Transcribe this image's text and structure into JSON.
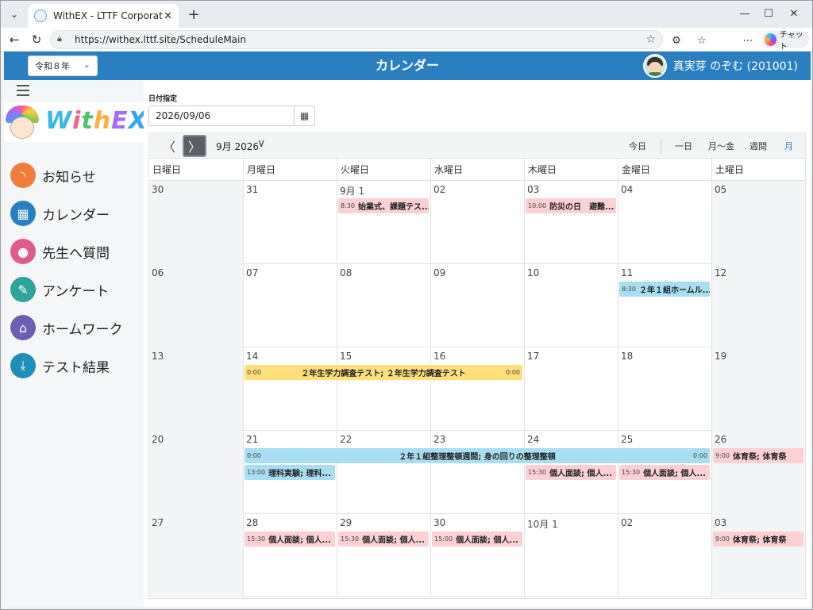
{
  "browser": {
    "tab_title": "WithEX - LTTF Corporation -",
    "url": "https://withex.lttf.site/ScheduleMain",
    "chat_label": "チャット"
  },
  "header": {
    "year": "令和８年",
    "title": "カレンダー",
    "user": "真実芽 のぞむ (201001)"
  },
  "sidebar": {
    "logo_text": "WithEX",
    "items": [
      {
        "label": "お知らせ",
        "icon": "rss-icon",
        "color": "#f07d3a",
        "glyph": "◝"
      },
      {
        "label": "カレンダー",
        "icon": "calendar-icon",
        "color": "#2a7fc0",
        "glyph": "▦"
      },
      {
        "label": "先生へ質問",
        "icon": "chat-bubble-icon",
        "color": "#e05a8a",
        "glyph": "●"
      },
      {
        "label": "アンケート",
        "icon": "pencil-icon",
        "color": "#2fa59a",
        "glyph": "✎"
      },
      {
        "label": "ホームワーク",
        "icon": "home-icon",
        "color": "#6a5fb0",
        "glyph": "⌂"
      },
      {
        "label": "テスト結果",
        "icon": "download-icon",
        "color": "#1f8fb8",
        "glyph": "⤓"
      }
    ]
  },
  "date_picker": {
    "label": "日付指定",
    "value": "2026/09/06"
  },
  "toolbar": {
    "month_title": "9月 2026",
    "today": "今日",
    "views": [
      "一日",
      "月～金",
      "週間",
      "月"
    ],
    "active_view": "月"
  },
  "calendar": {
    "dow": [
      "日曜日",
      "月曜日",
      "火曜日",
      "水曜日",
      "木曜日",
      "金曜日",
      "土曜日"
    ],
    "weeks": [
      [
        "30",
        "31",
        "9月 1",
        "02",
        "03",
        "04",
        "05"
      ],
      [
        "06",
        "07",
        "08",
        "09",
        "10",
        "11",
        "12"
      ],
      [
        "13",
        "14",
        "15",
        "16",
        "17",
        "18",
        "19"
      ],
      [
        "20",
        "21",
        "22",
        "23",
        "24",
        "25",
        "26"
      ],
      [
        "27",
        "28",
        "29",
        "30",
        "10月 1",
        "02",
        "03"
      ]
    ],
    "events": [
      {
        "week": 0,
        "start": 2,
        "span": 1,
        "row": 0,
        "time": "8:30",
        "title": "始業式、課題テス...",
        "color": "pink"
      },
      {
        "week": 0,
        "start": 4,
        "span": 1,
        "row": 0,
        "time": "10:00",
        "title": "防災の日　避難...",
        "color": "pink"
      },
      {
        "week": 1,
        "start": 5,
        "span": 1,
        "row": 0,
        "time": "8:30",
        "title": "２年１組ホームル...",
        "color": "blue"
      },
      {
        "week": 2,
        "start": 1,
        "span": 3,
        "row": 0,
        "time": "0:00",
        "title": "２年生学力調査テスト; ２年生学力調査テスト",
        "end_time": "0:00",
        "color": "yellow"
      },
      {
        "week": 3,
        "start": 1,
        "span": 5,
        "row": 0,
        "time": "0:00",
        "title": "２年１組整理整頓週間; 身の回りの整理整頓",
        "end_time": "0:00",
        "color": "blue"
      },
      {
        "week": 3,
        "start": 6,
        "span": 1,
        "row": 0,
        "time": "9:00",
        "title": "体育祭; 体育祭",
        "color": "pink"
      },
      {
        "week": 3,
        "start": 1,
        "span": 1,
        "row": 1,
        "time": "13:00",
        "title": "理科実験; 理科...",
        "color": "blue"
      },
      {
        "week": 3,
        "start": 4,
        "span": 1,
        "row": 1,
        "time": "15:30",
        "title": "個人面談; 個人...",
        "color": "pink"
      },
      {
        "week": 3,
        "start": 5,
        "span": 1,
        "row": 1,
        "time": "15:30",
        "title": "個人面談; 個人...",
        "color": "pink"
      },
      {
        "week": 4,
        "start": 1,
        "span": 1,
        "row": 0,
        "time": "15:30",
        "title": "個人面談; 個人...",
        "color": "pink"
      },
      {
        "week": 4,
        "start": 2,
        "span": 1,
        "row": 0,
        "time": "15:30",
        "title": "個人面談; 個人...",
        "color": "pink"
      },
      {
        "week": 4,
        "start": 3,
        "span": 1,
        "row": 0,
        "time": "15:00",
        "title": "個人面談; 個人...",
        "color": "pink"
      },
      {
        "week": 4,
        "start": 6,
        "span": 1,
        "row": 0,
        "time": "9:00",
        "title": "体育祭; 体育祭",
        "color": "pink"
      }
    ]
  }
}
